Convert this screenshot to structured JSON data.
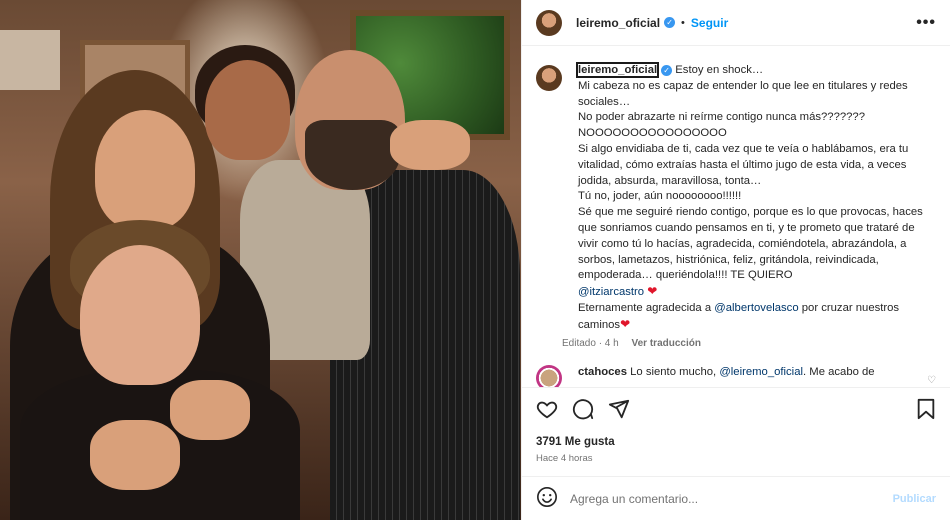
{
  "post": {
    "username": "leiremo_oficial",
    "separator": "•",
    "follow_label": "Seguir",
    "more_label": "•••",
    "verified_icon": "✓"
  },
  "caption": {
    "username": "leiremo_oficial",
    "lines": [
      "Estoy en shock…",
      "Mi cabeza no es capaz de entender lo que lee en titulares y redes sociales…",
      "No poder abrazarte ni reírme contigo nunca más???????",
      "NOOOOOOOOOOOOOOOO",
      "Si algo envidiaba de ti, cada vez que te veía o hablábamos, era tu vitalidad, cómo extraías hasta el último jugo de esta vida, a veces jodida, absurda, maravillosa, tonta…",
      "Tú no, joder, aún noooooooo!!!!!!",
      "Sé que me seguiré riendo contigo, porque es lo que provocas, haces que sonriamos cuando pensamos en ti, y te prometo que trataré de vivir como tú lo hacías, agradecida, comiéndotela, abrazándola, a sorbos, lametazos, histriónica, feliz, gritándola, reivindicada, empoderada… queriéndola!!!! TE QUIERO"
    ],
    "mention1": "@itziarcastro",
    "line_last_prefix": "Eternamente agradecida a",
    "mention2": "@albertovelasco",
    "line_last_suffix": "por cruzar nuestros caminos",
    "heart": "❤",
    "edited": "Editado · 4 h",
    "translate": "Ver traducción"
  },
  "comment": {
    "username": "ctahoces",
    "text": "Lo siento mucho,",
    "mention": "@leiremo_oficial",
    "text2": ". Me acabo de"
  },
  "likes": "3791 Me gusta",
  "time_ago": "Hace 4 horas",
  "composer": {
    "placeholder": "Agrega un comentario...",
    "publish_label": "Publicar"
  },
  "colors": {
    "accent": "#0095f6",
    "heart": "#e0162b",
    "verified": "#3897f0",
    "mention": "#00376b"
  }
}
